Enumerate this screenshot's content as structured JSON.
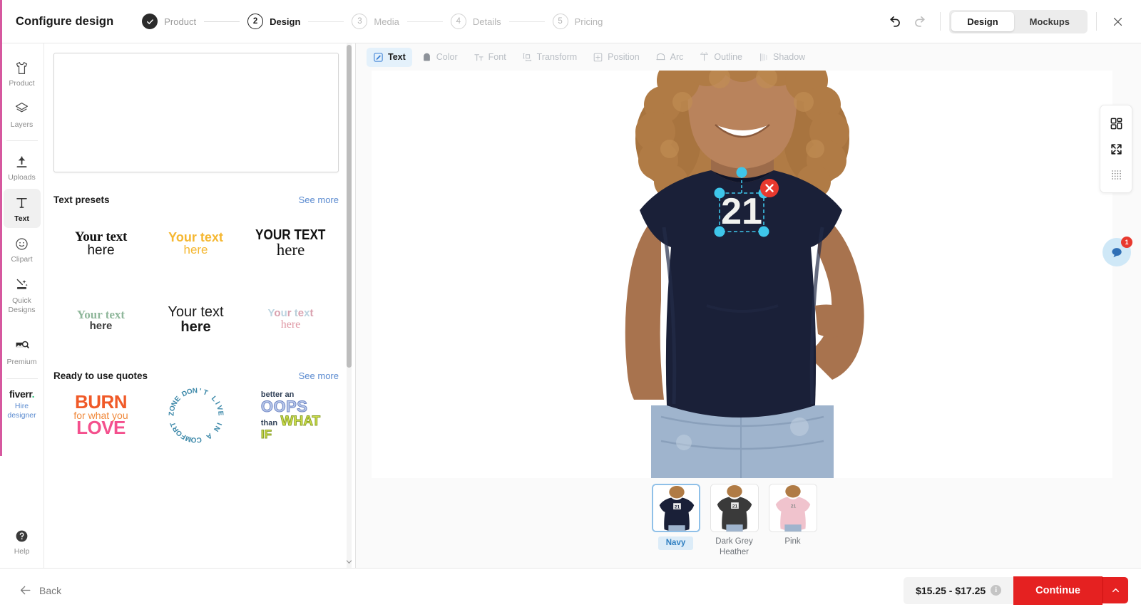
{
  "header": {
    "title": "Configure design",
    "steps": [
      {
        "num": "1",
        "label": "Product",
        "state": "done"
      },
      {
        "num": "2",
        "label": "Design",
        "state": "active"
      },
      {
        "num": "3",
        "label": "Media",
        "state": "todo"
      },
      {
        "num": "4",
        "label": "Details",
        "state": "todo"
      },
      {
        "num": "5",
        "label": "Pricing",
        "state": "todo"
      }
    ],
    "undo_icon": "undo-icon",
    "redo_icon": "redo-icon",
    "close_icon": "close-icon",
    "view_toggle": {
      "design": "Design",
      "mockups": "Mockups",
      "selected": "Design"
    }
  },
  "rail": {
    "items": [
      {
        "label": "Product",
        "icon": "tshirt-icon",
        "selected": false
      },
      {
        "label": "Layers",
        "icon": "layers-icon",
        "selected": false
      },
      {
        "label": "Uploads",
        "icon": "upload-icon",
        "selected": false
      },
      {
        "label": "Text",
        "icon": "text-icon",
        "selected": true
      },
      {
        "label": "Clipart",
        "icon": "smiley-icon",
        "selected": false
      },
      {
        "label": "Quick\nDesigns",
        "icon": "magic-wand-icon",
        "selected": false
      },
      {
        "label": "Premium",
        "icon": "premium-image-icon",
        "selected": false
      }
    ],
    "fiverr": {
      "logo": "fiverr",
      "dot": ".",
      "sub": "Hire\ndesigner"
    },
    "help": {
      "label": "Help",
      "icon": "help-icon"
    }
  },
  "panel": {
    "textarea_value": "",
    "textarea_placeholder": "",
    "presets_title": "Text presets",
    "presets_see_more": "See more",
    "presets": [
      {
        "line1": "Your text",
        "line2": "here",
        "style": "serif-black"
      },
      {
        "line1": "Your text",
        "line2": "here",
        "style": "yellow-sans"
      },
      {
        "line1": "YOUR TEXT",
        "line2": "here",
        "style": "condensed-bold"
      },
      {
        "line1": "Your text",
        "line2": "here",
        "style": "green-serif"
      },
      {
        "line1": "Your text",
        "line2": "here",
        "style": "light-bold-sans"
      },
      {
        "line1": "Your text",
        "line2": "here",
        "style": "pastel-multicolor"
      }
    ],
    "quotes_title": "Ready to use quotes",
    "quotes_see_more": "See more",
    "quotes": [
      {
        "name": "burn-for-what-you-love",
        "l1": "BURN",
        "l2": "for what you",
        "l3": "LOVE"
      },
      {
        "name": "dont-live-in-a-comfort-zone",
        "text": "DON'T LIVE IN A COMFORT ZONE"
      },
      {
        "name": "better-an-oops-than-what-if",
        "l1": "better an",
        "l2": "OOPS",
        "l3": "than",
        "l4": "WHAT",
        "l5": "IF"
      }
    ]
  },
  "toolbar": {
    "items": [
      {
        "label": "Text",
        "icon": "text-edit-icon",
        "active": true
      },
      {
        "label": "Color",
        "icon": "color-swatch-icon",
        "active": false
      },
      {
        "label": "Font",
        "icon": "font-icon",
        "active": false
      },
      {
        "label": "Transform",
        "icon": "transform-icon",
        "active": false
      },
      {
        "label": "Position",
        "icon": "position-icon",
        "active": false
      },
      {
        "label": "Arc",
        "icon": "arc-icon",
        "active": false
      },
      {
        "label": "Outline",
        "icon": "outline-icon",
        "active": false
      },
      {
        "label": "Shadow",
        "icon": "shadow-icon",
        "active": false
      }
    ]
  },
  "canvas": {
    "design_text": "21",
    "shirt_color": "#1a2038",
    "selection_handle_color": "#3ec6ea",
    "delete_button_color": "#e8392e",
    "right_tools": [
      {
        "name": "layout-grid-icon"
      },
      {
        "name": "fullscreen-expand-icon"
      },
      {
        "name": "dotted-grid-icon"
      }
    ],
    "fab": {
      "icon": "support-chat-icon",
      "badge": "1"
    }
  },
  "variants": [
    {
      "label": "Navy",
      "color": "#1a2038",
      "selected": true
    },
    {
      "label": "Dark Grey Heather",
      "color": "#3a3a3a",
      "selected": false
    },
    {
      "label": "Pink",
      "color": "#f0c3cd",
      "selected": false
    }
  ],
  "footer": {
    "back_label": "Back",
    "back_icon": "arrow-left-icon",
    "price": "$15.25 - $17.25",
    "info_icon": "info-icon",
    "continue_label": "Continue",
    "continue_chevron": "chevron-up-icon"
  },
  "colors": {
    "accent_pink": "#d6589f",
    "primary_red": "#e52121",
    "link_blue": "#5b8bd0",
    "toolbar_active_bg": "#e4f1fb"
  }
}
